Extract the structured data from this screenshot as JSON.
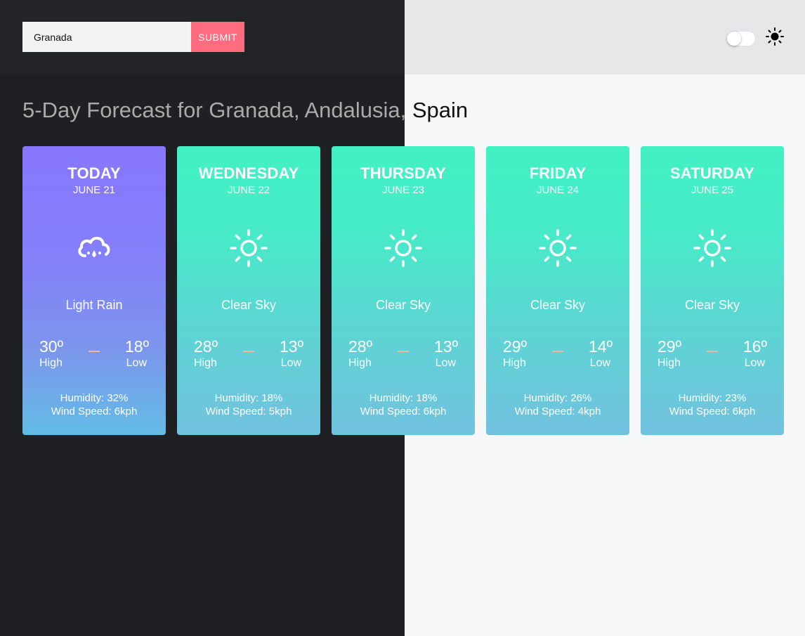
{
  "search": {
    "value": "Granada",
    "submit_label": "SUBMIT"
  },
  "page_title": "5-Day Forecast for Granada, Andalusia, Spain",
  "theme": {
    "mode_icon": "sun-icon",
    "toggle_on": false
  },
  "labels": {
    "high": "High",
    "low": "Low"
  },
  "colors": {
    "submit": "#ff6b7f",
    "dark_bg": "#1f2024",
    "light_bg": "#f6f7f9",
    "today_card_top": "#8877fe",
    "card_top": "#42f1c4",
    "card_bottom": "#72c1df"
  },
  "days": [
    {
      "name": "TODAY",
      "date": "JUNE 21",
      "icon": "rain-cloud-icon",
      "condition": "Light Rain",
      "high": "30º",
      "low": "18º",
      "humidity": "Humidity: 32%",
      "wind": "Wind Speed: 6kph"
    },
    {
      "name": "WEDNESDAY",
      "date": "JUNE 22",
      "icon": "sun-icon",
      "condition": "Clear Sky",
      "high": "28º",
      "low": "13º",
      "humidity": "Humidity: 18%",
      "wind": "Wind Speed: 5kph"
    },
    {
      "name": "THURSDAY",
      "date": "JUNE 23",
      "icon": "sun-icon",
      "condition": "Clear Sky",
      "high": "28º",
      "low": "13º",
      "humidity": "Humidity: 18%",
      "wind": "Wind Speed: 6kph"
    },
    {
      "name": "FRIDAY",
      "date": "JUNE 24",
      "icon": "sun-icon",
      "condition": "Clear Sky",
      "high": "29º",
      "low": "14º",
      "humidity": "Humidity: 26%",
      "wind": "Wind Speed: 4kph"
    },
    {
      "name": "SATURDAY",
      "date": "JUNE 25",
      "icon": "sun-icon",
      "condition": "Clear Sky",
      "high": "29º",
      "low": "16º",
      "humidity": "Humidity: 23%",
      "wind": "Wind Speed: 6kph"
    }
  ]
}
